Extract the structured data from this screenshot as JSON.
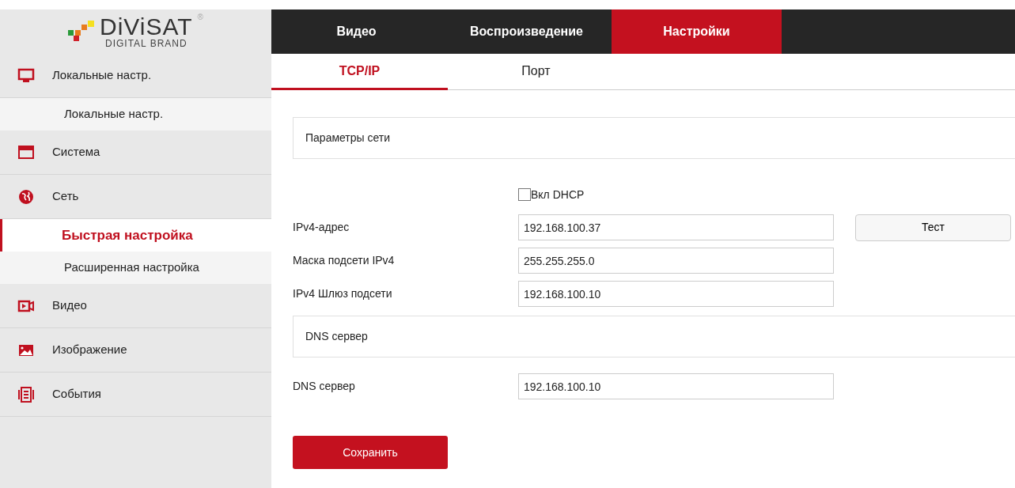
{
  "logo": {
    "wordmark": "DiViSAT",
    "tagline": "DIGITAL BRAND",
    "registered": "®"
  },
  "top_nav": [
    {
      "label": "Видео",
      "selected": false
    },
    {
      "label": "Воспроизведение",
      "selected": false
    },
    {
      "label": "Настройки",
      "selected": true
    }
  ],
  "sidebar": {
    "items": [
      {
        "label": "Локальные настр.",
        "selected": false,
        "children": [
          {
            "label": "Локальные настр.",
            "selected": false
          }
        ]
      },
      {
        "label": "Система",
        "selected": false
      },
      {
        "label": "Сеть",
        "selected": false,
        "children": [
          {
            "label": "Быстрая настройка",
            "selected": true
          },
          {
            "label": "Расширенная настройка",
            "selected": false
          }
        ]
      },
      {
        "label": "Видео",
        "selected": false
      },
      {
        "label": "Изображение",
        "selected": false
      },
      {
        "label": "События",
        "selected": false
      }
    ]
  },
  "sub_tabs": [
    {
      "label": "TCP/IP",
      "selected": true
    },
    {
      "label": "Порт",
      "selected": false
    }
  ],
  "sections": [
    {
      "title": "Параметры сети",
      "dhcp": {
        "label": "Вкл DHCP",
        "checked": false
      },
      "fields": [
        {
          "label": "IPv4-адрес",
          "value": "192.168.100.37",
          "button": "Тест"
        },
        {
          "label": "Маска подсети IPv4",
          "value": "255.255.255.0"
        },
        {
          "label": "IPv4 Шлюз подсети",
          "value": "192.168.100.10"
        }
      ]
    },
    {
      "title": "DNS сервер",
      "fields": [
        {
          "label": "DNS сервер",
          "value": "192.168.100.10"
        }
      ]
    }
  ],
  "save_button": "Сохранить"
}
